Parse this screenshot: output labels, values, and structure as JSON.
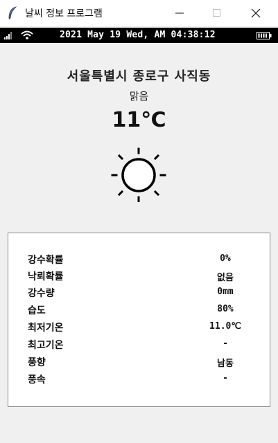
{
  "window": {
    "title": "날씨 정보 프로그램",
    "icon": "feather-icon"
  },
  "statusbar": {
    "datetime": "2021 May 19 Wed, AM 04:38:12",
    "icons": [
      "signal-icon",
      "wifi-icon",
      "battery-icon"
    ]
  },
  "weather": {
    "location": "서울특별시 종로구 사직동",
    "condition": "맑음",
    "temperature": "11℃",
    "icon": "sun-icon"
  },
  "details": [
    {
      "label": "강수확률",
      "value": "0%"
    },
    {
      "label": "낙뢰확률",
      "value": "없음"
    },
    {
      "label": "강수량",
      "value": "0mm"
    },
    {
      "label": "습도",
      "value": "80%"
    },
    {
      "label": "최저기온",
      "value": "11.0℃"
    },
    {
      "label": "최고기온",
      "value": "-"
    },
    {
      "label": "풍향",
      "value": "남동"
    },
    {
      "label": "풍속",
      "value": "-"
    }
  ]
}
